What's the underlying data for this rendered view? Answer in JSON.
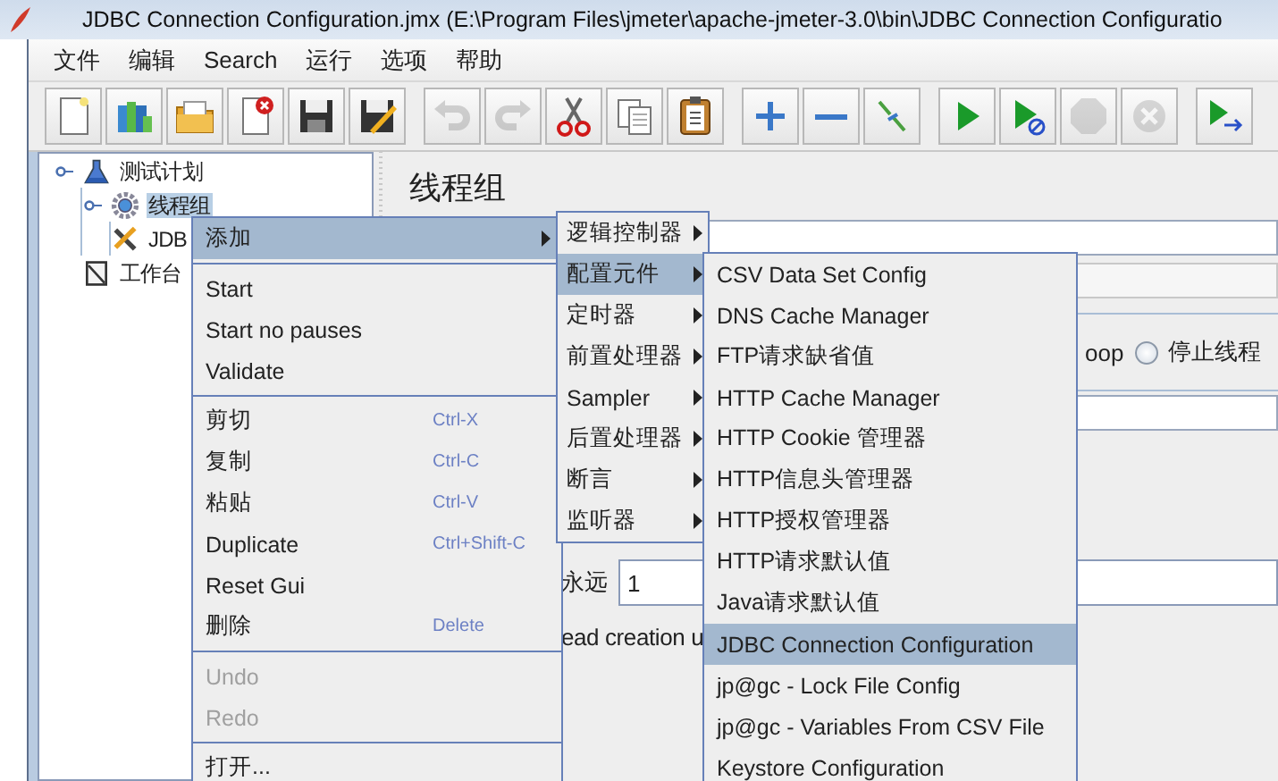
{
  "window": {
    "title": "JDBC Connection Configuration.jmx (E:\\Program Files\\jmeter\\apache-jmeter-3.0\\bin\\JDBC Connection Configuratio"
  },
  "menu_bar": [
    "文件",
    "编辑",
    "Search",
    "运行",
    "选项",
    "帮助"
  ],
  "toolbar_groups": [
    {
      "buttons": [
        {
          "disabled": false
        },
        {
          "disabled": false
        },
        {
          "disabled": false
        },
        {
          "disabled": false
        },
        {
          "disabled": false
        },
        {
          "disabled": false
        }
      ]
    },
    {
      "buttons": [
        {
          "disabled": true
        },
        {
          "disabled": true
        },
        {
          "disabled": false
        },
        {
          "disabled": false
        },
        {
          "disabled": false
        }
      ]
    },
    {
      "buttons": [
        {
          "disabled": false
        },
        {
          "disabled": false
        },
        {
          "disabled": false
        }
      ]
    },
    {
      "buttons": [
        {
          "disabled": false
        },
        {
          "disabled": false
        },
        {
          "disabled": true
        },
        {
          "disabled": true
        }
      ]
    },
    {
      "buttons": [
        {
          "disabled": false
        }
      ]
    }
  ],
  "tree": [
    {
      "label": "测试计划",
      "kind": "plan",
      "selected": false,
      "children": [
        {
          "label": "线程组",
          "kind": "threadgroup",
          "selected": true,
          "children": [
            {
              "label": "JDB",
              "kind": "config",
              "selected": false
            }
          ]
        }
      ]
    },
    {
      "label": "工作台",
      "kind": "workbench",
      "selected": false
    }
  ],
  "panel": {
    "title": "线程组",
    "radio_prefix": "oop",
    "radio": {
      "label": "停止线程",
      "selected": false
    },
    "loop_label": "永远",
    "loop_value": "1",
    "ramp_text": "ead creation u"
  },
  "context_menu": {
    "sections": [
      [
        {
          "label": "添加",
          "kind": "submenu",
          "selected": true,
          "disabled": false
        }
      ],
      [
        {
          "label": "Start",
          "kind": "command",
          "selected": false,
          "disabled": false
        },
        {
          "label": "Start no pauses",
          "kind": "command",
          "selected": false,
          "disabled": false
        },
        {
          "label": "Validate",
          "kind": "command",
          "selected": false,
          "disabled": false
        }
      ],
      [
        {
          "label": "剪切",
          "shortcut": "Ctrl-X",
          "kind": "command",
          "selected": false,
          "disabled": false
        },
        {
          "label": "复制",
          "shortcut": "Ctrl-C",
          "kind": "command",
          "selected": false,
          "disabled": false
        },
        {
          "label": "粘贴",
          "shortcut": "Ctrl-V",
          "kind": "command",
          "selected": false,
          "disabled": false
        },
        {
          "label": "Duplicate",
          "shortcut": "Ctrl+Shift-C",
          "kind": "command",
          "selected": false,
          "disabled": false
        },
        {
          "label": "Reset Gui",
          "kind": "command",
          "selected": false,
          "disabled": false
        },
        {
          "label": "删除",
          "shortcut": "Delete",
          "kind": "command",
          "selected": false,
          "disabled": false
        }
      ],
      [
        {
          "label": "Undo",
          "kind": "command",
          "selected": false,
          "disabled": true
        },
        {
          "label": "Redo",
          "kind": "command",
          "selected": false,
          "disabled": true
        }
      ],
      [
        {
          "label": "打开...",
          "kind": "command",
          "selected": false,
          "disabled": false
        }
      ]
    ]
  },
  "add_submenu": [
    {
      "label": "逻辑控制器",
      "kind": "submenu",
      "selected": false
    },
    {
      "label": "配置元件",
      "kind": "submenu",
      "selected": true
    },
    {
      "label": "定时器",
      "kind": "submenu",
      "selected": false
    },
    {
      "label": "前置处理器",
      "kind": "submenu",
      "selected": false
    },
    {
      "label": "Sampler",
      "kind": "submenu",
      "selected": false
    },
    {
      "label": "后置处理器",
      "kind": "submenu",
      "selected": false
    },
    {
      "label": "断言",
      "kind": "submenu",
      "selected": false
    },
    {
      "label": "监听器",
      "kind": "submenu",
      "selected": false
    }
  ],
  "config_submenu": [
    {
      "label": "CSV Data Set Config",
      "selected": false
    },
    {
      "label": "DNS Cache Manager",
      "selected": false
    },
    {
      "label": "FTP请求缺省值",
      "selected": false
    },
    {
      "label": "HTTP Cache Manager",
      "selected": false
    },
    {
      "label": "HTTP Cookie 管理器",
      "selected": false
    },
    {
      "label": "HTTP信息头管理器",
      "selected": false
    },
    {
      "label": "HTTP授权管理器",
      "selected": false
    },
    {
      "label": "HTTP请求默认值",
      "selected": false
    },
    {
      "label": "Java请求默认值",
      "selected": false
    },
    {
      "label": "JDBC Connection Configuration",
      "selected": true
    },
    {
      "label": "jp@gc - Lock File Config",
      "selected": false
    },
    {
      "label": "jp@gc - Variables From CSV File",
      "selected": false
    },
    {
      "label": "Keystore Configuration",
      "selected": false
    }
  ]
}
